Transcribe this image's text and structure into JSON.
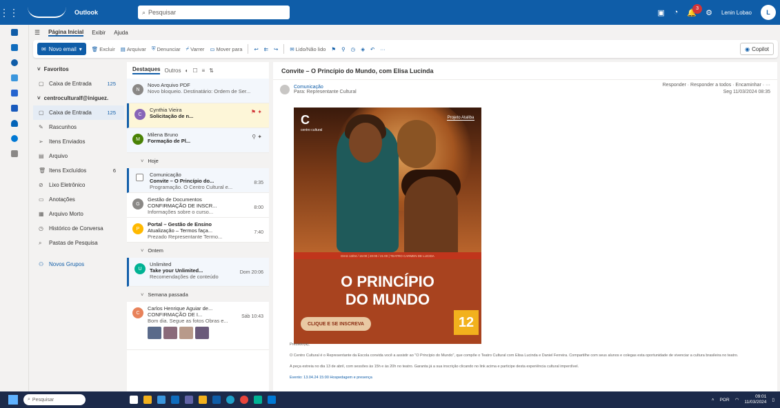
{
  "app": {
    "name": "Outlook",
    "user": "Lenin Lobao",
    "user_initial": "L",
    "notif_count": "3"
  },
  "search": {
    "placeholder": "Pesquisar"
  },
  "ribbon_tabs": [
    "Página Inicial",
    "Exibir",
    "Ajuda"
  ],
  "ribbon": {
    "new_mail": "Novo email",
    "buttons": [
      "Excluir",
      "Arquivar",
      "Denunciar",
      "Varrer",
      "Mover para",
      "Marcar como lido",
      "Categorizar",
      "Lido/Não lido"
    ],
    "copilot": "Copilot"
  },
  "folders": {
    "favorites": "Favoritos",
    "fav_inbox": "Caixa de Entrada",
    "fav_inbox_count": "125",
    "account": "centroculturalf@iniguez.",
    "items": [
      {
        "label": "Caixa de Entrada",
        "count": "125",
        "icon": "inbox-icon"
      },
      {
        "label": "Rascunhos",
        "count": "",
        "icon": "draft-icon"
      },
      {
        "label": "Itens Enviados",
        "count": "",
        "icon": "send-icon"
      },
      {
        "label": "Arquivo",
        "count": "",
        "icon": "archive-icon"
      },
      {
        "label": "Itens Excluídos",
        "count": "6",
        "icon": "trash-icon"
      },
      {
        "label": "Lixo Eletrônico",
        "count": "",
        "icon": "junk-icon"
      },
      {
        "label": "Anotações",
        "count": "",
        "icon": "note-icon"
      },
      {
        "label": "Arquivo Morto",
        "count": "",
        "icon": "archive2-icon"
      },
      {
        "label": "Histórico de Conversa",
        "count": "",
        "icon": "history-icon"
      },
      {
        "label": "Pastas de Pesquisa",
        "count": "",
        "icon": "searchfolder-icon"
      }
    ],
    "new_group": "Novos Grupos"
  },
  "list": {
    "tab_focused": "Destaques",
    "tab_other": "Outros",
    "items": [
      {
        "from": "Novo Arquivo PDF",
        "subject": "",
        "preview": "Novo bloqueio. Destinatário: Ordem de Ser...",
        "time": "",
        "initial": "N",
        "color": "#8a8886"
      },
      {
        "from": "Cynthia Vieira",
        "subject": "Solicitação de n...",
        "preview": "",
        "time": "",
        "initial": "C",
        "color": "#8764b8"
      },
      {
        "from": "Milena Bruno",
        "subject": "Formação de Pl...",
        "preview": "",
        "time": "",
        "initial": "M",
        "color": "#498205"
      }
    ],
    "group_today": "Hoje",
    "today": [
      {
        "from": "Comunicação",
        "subject": "Convite – O Princípio do...",
        "preview": "Programação. O Centro Cultural e...",
        "time": "8:35",
        "initial": "",
        "color": "#ffffff"
      },
      {
        "from": "Gestão de Documentos",
        "subject": "CONFIRMAÇÃO DE INSCR...",
        "preview": "Informações sobre o curso...",
        "time": "8:00",
        "initial": "G",
        "color": "#8a8886"
      },
      {
        "from": "Portal – Gestão de Ensino",
        "subject": "Atualização – Termos faça...",
        "preview": "Prezado Representante Termo...",
        "time": "7:40",
        "initial": "P",
        "color": "#ffb900"
      }
    ],
    "group_yesterday": "Ontem",
    "yesterday": [
      {
        "from": "Unlimited",
        "subject": "Take your Unlimited...",
        "preview": "Recomendações de conteúdo",
        "time": "Dom 20:06",
        "initial": "U",
        "color": "#00b294"
      }
    ],
    "group_lastweek": "Semana passada",
    "lastweek": [
      {
        "from": "Carlos Henrique Aguiar de...",
        "subject": "CONFIRMAÇÃO DE I...",
        "preview": "Bom dia. Segue as fotos Obras e...",
        "time": "Sáb 10:43",
        "initial": "C",
        "color": "#e8825a"
      }
    ]
  },
  "reading": {
    "subject": "Convite – O Princípio do Mundo, com Elisa Lucinda",
    "sender": "Comunicação",
    "sender_to": "Para: Representante Cultural",
    "actions": "Responder · Responder a todos · Encaminhar · ···",
    "date": "Seg 11/03/2024 08:35",
    "poster_logo": "C",
    "poster_logo_label": "centro cultural",
    "poster_brand": "Projeto Ataliba",
    "poster_strip": "DIAS 13/04 / 15:00 | 20:00 / 21:00 | TEATRO CARMEN DE LUCIDA",
    "poster_title_1": "O PRINCÍPIO",
    "poster_title_2": "DO MUNDO",
    "poster_cta": "CLIQUE E SE INSCREVA",
    "poster_age": "12",
    "p1": "Prezado(a),",
    "p2": "O Centro Cultural é o Representante da Escola convida você a assistir ao \"O Princípio do Mundo\", que compõe o Teatro Cultural com Elisa Lucinda e Daniel Ferreira. Compartilhe com seus alunos e colegas esta oportunidade de vivenciar a cultura brasileira no teatro.",
    "p3": "A peça estreia no dia 13 de abril, com sessões às 15h e às 20h no teatro. Garanta já a sua inscrição clicando no link acima e participe desta experiência cultural imperdível.",
    "note": "Evento: 13.04.24 15:00 Hospedagem e presença"
  },
  "taskbar": {
    "search": "Pesquisar",
    "time": "09:01",
    "date": "11/03/2024",
    "lang": "POR"
  }
}
